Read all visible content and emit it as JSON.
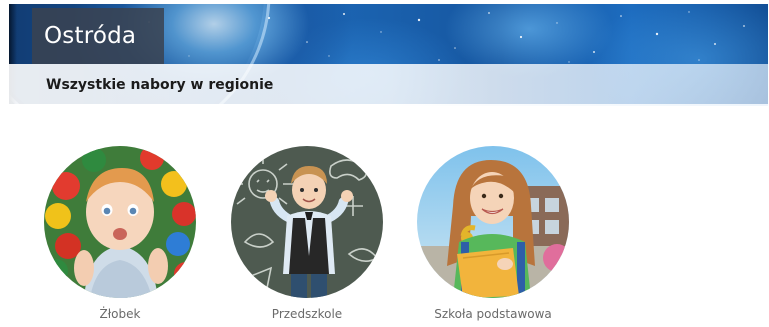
{
  "banner": {
    "title": "Ostróda",
    "subtitle": "Wszystkie nabory w regionie"
  },
  "categories": [
    {
      "label": "Żłobek",
      "image": "toddler-in-ball-pit"
    },
    {
      "label": "Przedszkole",
      "image": "boy-at-chalkboard"
    },
    {
      "label": "Szkoła podstawowa",
      "image": "girl-with-backpack"
    }
  ],
  "colors": {
    "title_box": "#3a4250",
    "banner_blue": "#1b63b0",
    "label_gray": "#6a6a6a"
  }
}
